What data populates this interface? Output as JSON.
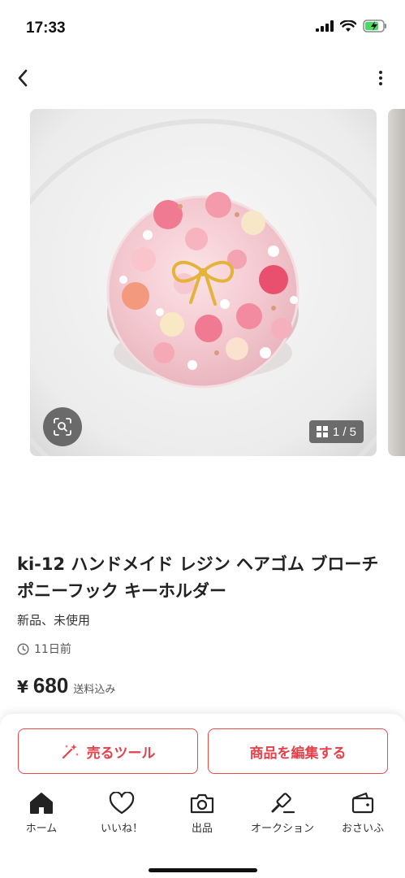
{
  "status_bar": {
    "time": "17:33"
  },
  "gallery": {
    "counter": "1 / 5"
  },
  "product": {
    "title": "ki-12 ハンドメイド レジン ヘアゴム ブローチ ポニーフック キーホルダー",
    "condition": "新品、未使用",
    "posted": "11日前",
    "price_symbol": "¥",
    "price": "680",
    "shipping": "送料込み"
  },
  "actions": {
    "sell_tool": "売るツール",
    "edit_item": "商品を編集する"
  },
  "tabbar": [
    {
      "label": "ホーム",
      "icon": "home-icon"
    },
    {
      "label": "いいね！",
      "icon": "heart-icon"
    },
    {
      "label": "出品",
      "icon": "camera-icon"
    },
    {
      "label": "オークション",
      "icon": "gavel-icon"
    },
    {
      "label": "おさいふ",
      "icon": "wallet-icon"
    }
  ],
  "colors": {
    "accent": "#e8404a",
    "text": "#222222"
  }
}
